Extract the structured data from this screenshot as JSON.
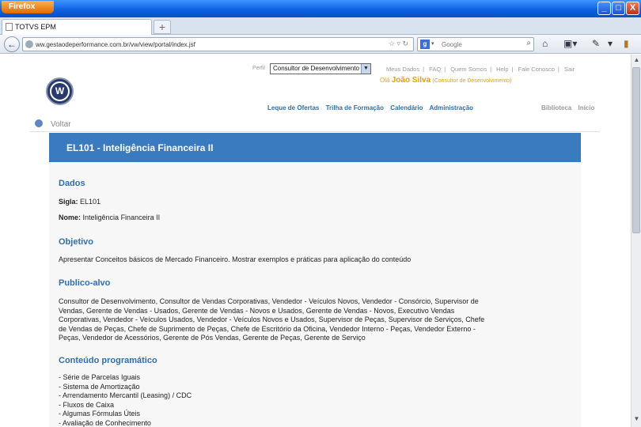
{
  "browser": {
    "firefox_button": "Firefox",
    "tab_title": "TOTVS EPM",
    "url": "ww.gestaodeperformance.com.br/vw/view/portal/index.jsf",
    "search_engine": "Google",
    "win_minimize": "_",
    "win_maximize": "□",
    "win_close": "X"
  },
  "header": {
    "perfil_label": "Perfil",
    "perfil_value": "Consultor de Desenvolvimento",
    "links": [
      "Meus Dados",
      "FAQ",
      "Quem Somos",
      "Help",
      "Fale Conosco",
      "Sair"
    ],
    "greeting_prefix": "Olá",
    "user_name": "João Silva",
    "user_role": "(Consultor de Desenvolvimento)",
    "nav": [
      "Leque de Ofertas",
      "Trilha de Formação",
      "Calendário",
      "Administração"
    ],
    "nav_right": [
      "Biblioteca",
      "Início"
    ]
  },
  "voltar": "Voltar",
  "course": {
    "title": "EL101 - Inteligência Financeira II",
    "dados_heading": "Dados",
    "sigla_label": "Sigla:",
    "sigla_value": "EL101",
    "nome_label": "Nome:",
    "nome_value": "Inteligência Financeira II",
    "objetivo_heading": "Objetivo",
    "objetivo_text": "Apresentar Conceitos básicos de Mercado Financeiro. Mostrar exemplos e práticas para aplicação do conteúdo",
    "publico_heading": "Publico-alvo",
    "publico_lines": [
      "Consultor de Desenvolvimento, Consultor de Vendas Corporativas, Vendedor - Veículos Novos, Vendedor - Consórcio, Supervisor de",
      "Vendas, Gerente de Vendas - Usados, Gerente de Vendas - Novos e Usados, Gerente de Vendas - Novos, Executivo Vendas",
      "Corporativas, Vendedor - Veículos Usados, Vendedor - Veículos Novos e Usados, Supervisor de Peças, Supervisor de Serviços, Chefe",
      "de Vendas de Peças, Chefe de Suprimento de Peças, Chefe de Escritório da Oficina, Vendedor Interno - Peças, Vendedor Externo -",
      "Peças, Vendedor de Acessórios, Gerente de Pós Vendas, Gerente de Peças, Gerente de Serviço"
    ],
    "conteudo_heading": "Conteúdo programático",
    "conteudo_items": [
      "- Série de Parcelas Iguais",
      "- Sistema de Amortização",
      "- Arrendamento Mercantil (Leasing) / CDC",
      "- Fluxos de Caixa",
      "- Algumas Fórmulas Úteis",
      "- Avaliação de Conhecimento"
    ]
  }
}
